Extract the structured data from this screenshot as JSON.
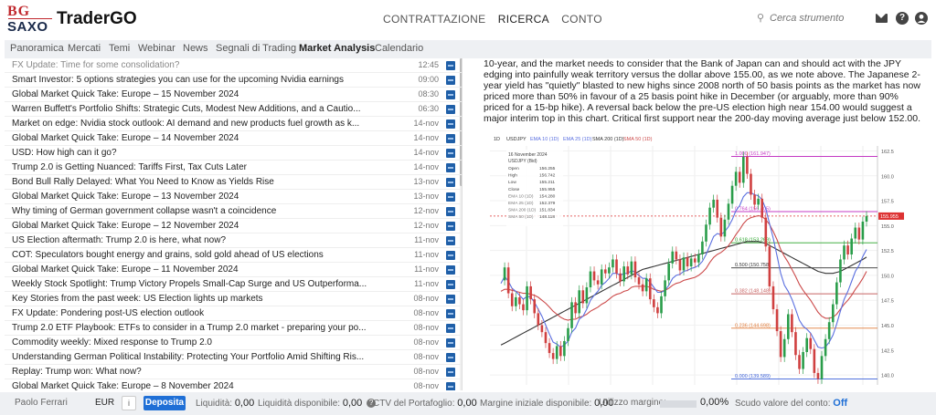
{
  "header": {
    "logo_top": "BG",
    "logo_bottom": "SAXO",
    "brand": "TraderGO",
    "nav": [
      "CONTRATTAZIONE",
      "RICERCA",
      "CONTO"
    ],
    "search_placeholder": "Cerca strumento",
    "help_label": "?"
  },
  "tabs": [
    "Panoramica",
    "Mercati",
    "Temi",
    "Webinar",
    "News",
    "Segnali di Trading",
    "Market Analysis",
    "Calendario"
  ],
  "active_tab": "Market Analysis",
  "news": [
    {
      "title": "FX Update: Time for some consolidation?",
      "date": "12:45"
    },
    {
      "title": "Smart Investor: 5 options strategies you can use for the upcoming Nvidia earnings",
      "date": "09:00"
    },
    {
      "title": "Global Market Quick Take: Europe – 15 November 2024",
      "date": "08:30"
    },
    {
      "title": "Warren Buffett's Portfolio Shifts: Strategic Cuts, Modest New Additions, and a Cautio...",
      "date": "06:30"
    },
    {
      "title": "Market on edge: Nvidia stock outlook: AI demand and new products fuel growth as k...",
      "date": "14-nov"
    },
    {
      "title": "Global Market Quick Take: Europe – 14 November 2024",
      "date": "14-nov"
    },
    {
      "title": "USD: How high can it go?",
      "date": "14-nov"
    },
    {
      "title": "Trump 2.0 is Getting Nuanced: Tariffs First, Tax Cuts Later",
      "date": "14-nov"
    },
    {
      "title": "Bond Bull Rally Delayed: What You Need to Know as Yields Rise",
      "date": "13-nov"
    },
    {
      "title": "Global Market Quick Take: Europe – 13 November 2024",
      "date": "13-nov"
    },
    {
      "title": "Why timing of German government collapse wasn't a coincidence",
      "date": "12-nov"
    },
    {
      "title": "Global Market Quick Take: Europe – 12 November 2024",
      "date": "12-nov"
    },
    {
      "title": "US Election aftermath: Trump 2.0 is here, what now?",
      "date": "11-nov"
    },
    {
      "title": "COT: Speculators bought energy and grains, sold gold ahead of US elections",
      "date": "11-nov"
    },
    {
      "title": "Global Market Quick Take: Europe – 11 November 2024",
      "date": "11-nov"
    },
    {
      "title": "Weekly Stock Spotlight: Trump Victory Propels Small-Cap Surge and US Outperforma...",
      "date": "11-nov"
    },
    {
      "title": "Key Stories from the past week: US Election lights up markets",
      "date": "08-nov"
    },
    {
      "title": "FX Update: Pondering post-US election outlook",
      "date": "08-nov"
    },
    {
      "title": "Trump 2.0 ETF Playbook: ETFs to consider in a Trump 2.0 market - preparing your po...",
      "date": "08-nov"
    },
    {
      "title": "Commodity weekly: Mixed response to Trump 2.0",
      "date": "08-nov"
    },
    {
      "title": "Understanding German Political Instability: Protecting Your Portfolio Amid Shifting Ris...",
      "date": "08-nov"
    },
    {
      "title": "Replay: Trump won: What now?",
      "date": "08-nov"
    },
    {
      "title": "Global Market Quick Take: Europe – 8 November 2024",
      "date": "08-nov"
    }
  ],
  "article": {
    "paragraph": "10-year, and the market needs to consider that the Bank of Japan can and should act with the JPY edging into painfully weak territory versus the dollar above 155.00, as we note above. The Japanese 2-year yield has \"quietly\" blasted to new highs since 2008 north of 50 basis points as the market has now priced more than 50% in favour of a 25 basis point hike in December (or arguably, more than 90% priced for a 15-bp hike). A reversal back below the pre-US election high near 154.00 would suggest a major interim top in this chart. Critical first support near the 200-day moving average just below 152.00."
  },
  "chart_data": {
    "type": "line",
    "interval": "1D",
    "symbol": "USDJPY",
    "legend": [
      "EMA 10 (1D)",
      "EMA 25 (1D)",
      "SMA 200 (1D)",
      "SMA 50 (1D)"
    ],
    "info_box": {
      "date": "16 November 2024",
      "title": "USDJPY (Bid)",
      "rows": [
        {
          "k": "Open",
          "v": "156.255"
        },
        {
          "k": "High",
          "v": "156.742"
        },
        {
          "k": "Low",
          "v": "155.211"
        },
        {
          "k": "Close",
          "v": "155.955"
        },
        {
          "k": "EMA 10 (1D)",
          "v": "154.280"
        },
        {
          "k": "EMA 25 (1D)",
          "v": "152.379"
        },
        {
          "k": "SMA 200 (1D)",
          "v": "151.834"
        },
        {
          "k": "SMA 50 (1D)",
          "v": "148.118"
        }
      ]
    },
    "ylim": [
      139,
      163
    ],
    "yticks": [
      140.0,
      142.5,
      145.0,
      147.5,
      150.0,
      152.5,
      155.0,
      157.5,
      160.0,
      162.5
    ],
    "fib_levels": [
      {
        "label": "1.000 (161.947)",
        "value": 161.947,
        "color": "#c43bc4"
      },
      {
        "label": "0.764 (156.405)",
        "value": 156.405,
        "color": "#c43bc4"
      },
      {
        "label": "0.618 (153.269)",
        "value": 153.269,
        "color": "#2aa52a"
      },
      {
        "label": "0.500 (150.758)",
        "value": 150.758,
        "color": "#333333"
      },
      {
        "label": "0.382 (148.148)",
        "value": 148.148,
        "color": "#c86464"
      },
      {
        "label": "0.236 (144.698)",
        "value": 144.698,
        "color": "#e07b39"
      },
      {
        "label": "0.000 (139.589)",
        "value": 139.589,
        "color": "#3a5fd8"
      }
    ],
    "last_price": "155.955",
    "last_price_value": 155.955,
    "series": [
      {
        "key": "price",
        "color": "#222222",
        "values": [
          149.5,
          150.8,
          148.2,
          146.9,
          147.8,
          147.1,
          146.5,
          148.9,
          147.6,
          146.2,
          145.0,
          144.3,
          143.2,
          142.2,
          141.6,
          142.9,
          141.9,
          143.4,
          144.7,
          147.3,
          146.2,
          148.5,
          147.2,
          148.8,
          150.4,
          149.5,
          149.1,
          150.6,
          150.2,
          150.8,
          151.6,
          150.2,
          149.4,
          150.9,
          150.1,
          151.4,
          149.8,
          149.1,
          148.4,
          149.7,
          147.6,
          146.8,
          146.2,
          147.9,
          149.5,
          151.2,
          152.4,
          151.6,
          150.5,
          151.8,
          150.9,
          151.7,
          151.3,
          152.1,
          153.4,
          155.1,
          156.8,
          157.6,
          155.8,
          153.9,
          155.6,
          157.2,
          159.0,
          160.4,
          159.3,
          161.9,
          160.2,
          158.1,
          157.1,
          157.7,
          155.8,
          152.9,
          148.9,
          146.6,
          144.4,
          141.8,
          143.6,
          146.1,
          144.3,
          142.0,
          140.6,
          142.3,
          143.7,
          142.6,
          140.2,
          139.6,
          141.9,
          143.6,
          145.3,
          147.1,
          149.3,
          151.6,
          153.0,
          152.1,
          153.7,
          154.8,
          153.6,
          155.4,
          155.96
        ]
      },
      {
        "key": "ema10",
        "color": "#5a6fe0",
        "values": [
          149.2,
          149.9,
          149.4,
          148.7,
          148.4,
          148.0,
          147.6,
          147.9,
          147.8,
          147.3,
          146.6,
          145.9,
          145.0,
          144.1,
          143.3,
          143.1,
          142.8,
          143.0,
          143.4,
          144.3,
          144.7,
          145.6,
          145.9,
          146.6,
          147.5,
          148.0,
          148.4,
          149.0,
          149.3,
          149.7,
          150.2,
          150.2,
          150.0,
          150.2,
          150.2,
          150.5,
          150.3,
          150.0,
          149.7,
          149.7,
          149.3,
          148.8,
          148.3,
          148.3,
          148.5,
          149.0,
          149.7,
          150.0,
          150.1,
          150.4,
          150.5,
          150.7,
          150.8,
          151.0,
          151.4,
          152.1,
          153.0,
          153.9,
          154.2,
          154.1,
          154.4,
          154.9,
          155.6,
          156.5,
          157.0,
          157.9,
          158.3,
          158.3,
          158.1,
          158.0,
          157.6,
          156.7,
          155.2,
          153.7,
          152.0,
          150.2,
          149.0,
          148.4,
          147.6,
          146.6,
          145.5,
          144.9,
          144.6,
          144.2,
          143.5,
          142.8,
          142.7,
          142.8,
          143.3,
          144.0,
          145.1,
          146.4,
          147.6,
          148.4,
          149.4,
          150.4,
          151.0,
          151.9,
          152.6
        ]
      },
      {
        "key": "ema25",
        "color": "#cc4a4a",
        "values": [
          148.4,
          148.6,
          148.6,
          148.5,
          148.4,
          148.3,
          148.2,
          148.2,
          148.1,
          148.0,
          147.8,
          147.5,
          147.2,
          146.8,
          146.4,
          146.1,
          145.8,
          145.6,
          145.5,
          145.6,
          145.6,
          145.8,
          145.9,
          146.1,
          146.4,
          146.6,
          146.8,
          147.1,
          147.3,
          147.6,
          147.9,
          148.1,
          148.2,
          148.4,
          148.5,
          148.8,
          148.9,
          148.9,
          148.9,
          148.9,
          148.8,
          148.6,
          148.5,
          148.4,
          148.5,
          148.7,
          149.0,
          149.2,
          149.3,
          149.5,
          149.6,
          149.7,
          149.8,
          150.0,
          150.3,
          150.7,
          151.3,
          151.8,
          152.1,
          152.3,
          152.6,
          153.0,
          153.5,
          154.1,
          154.6,
          155.2,
          155.6,
          155.8,
          155.9,
          156.0,
          155.9,
          155.6,
          155.1,
          154.4,
          153.6,
          152.6,
          151.9,
          151.3,
          150.6,
          149.9,
          149.1,
          148.5,
          148.0,
          147.5,
          146.9,
          146.3,
          145.9,
          145.7,
          145.7,
          145.8,
          146.1,
          146.6,
          147.1,
          147.5,
          148.0,
          148.6,
          149.1,
          149.7,
          150.4
        ]
      },
      {
        "key": "sma200",
        "color": "#333333",
        "values": [
          143.0,
          143.2,
          143.4,
          143.6,
          143.8,
          144.0,
          144.2,
          144.4,
          144.6,
          144.8,
          145.0,
          145.2,
          145.4,
          145.6,
          145.8,
          146.0,
          146.2,
          146.4,
          146.6,
          146.8,
          147.0,
          147.2,
          147.4,
          147.6,
          147.8,
          148.0,
          148.2,
          148.4,
          148.6,
          148.8,
          149.0,
          149.2,
          149.4,
          149.6,
          149.8,
          150.0,
          150.2,
          150.4,
          150.6,
          150.7,
          150.8,
          150.9,
          151.0,
          151.1,
          151.2,
          151.3,
          151.4,
          151.5,
          151.6,
          151.7,
          151.8,
          151.9,
          152.0,
          152.1,
          152.2,
          152.3,
          152.4,
          152.5,
          152.6,
          152.7,
          152.8,
          152.9,
          153.0,
          153.1,
          153.2,
          153.3,
          153.4,
          153.4,
          153.4,
          153.4,
          153.3,
          153.2,
          153.0,
          152.8,
          152.6,
          152.4,
          152.2,
          152.0,
          151.8,
          151.6,
          151.4,
          151.2,
          151.0,
          150.8,
          150.6,
          150.4,
          150.3,
          150.2,
          150.2,
          150.2,
          150.3,
          150.4,
          150.6,
          150.8,
          151.0,
          151.2,
          151.4,
          151.6,
          151.83
        ]
      }
    ]
  },
  "footer": {
    "user": "Paolo Ferrari",
    "currency": "EUR",
    "info_label": "i",
    "deposit_label": "Deposita",
    "liquidity_label": "Liquidità:",
    "liquidity_value": "0,00",
    "available_label": "Liquidità disponibile:",
    "available_value": "0,00",
    "help_label": "?",
    "ctv_label": "CTV del Portafoglio:",
    "ctv_value": "0,00",
    "margin_label": "Margine iniziale disponibile:",
    "margin_value": "0,00",
    "usage_label": "Utilizzo margine:",
    "usage_value": "0,00%",
    "shield_label": "Scudo valore del conto:",
    "shield_value": "Off"
  }
}
